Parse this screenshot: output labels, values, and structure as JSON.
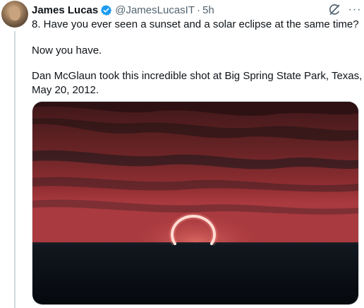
{
  "author": {
    "name": "James Lucas",
    "handle": "@JamesLucasIT",
    "separator": "·",
    "time": "5h",
    "verified_color": "#1d9bf0"
  },
  "actions": {
    "grok_icon": "grok-slash-icon",
    "more_icon": "more-dots-icon",
    "more_label": "···"
  },
  "tweet": {
    "line1": "8. Have you ever seen a sunset and a solar eclipse at the same time?",
    "line2": "Now you have.",
    "line3": "Dan McGlaun took this incredible shot at Big Spring State Park, Texas, on",
    "line4": "May 20, 2012."
  },
  "media": {
    "type": "photo",
    "subject": "annular solar eclipse ring at sunset over horizon",
    "colors": {
      "sky_top": "#4a1c1e",
      "sky_mid": "#8a2f30",
      "horizon_glow": "#b8444a",
      "ground": "#0b1016",
      "ring": "#fff3ec"
    }
  }
}
